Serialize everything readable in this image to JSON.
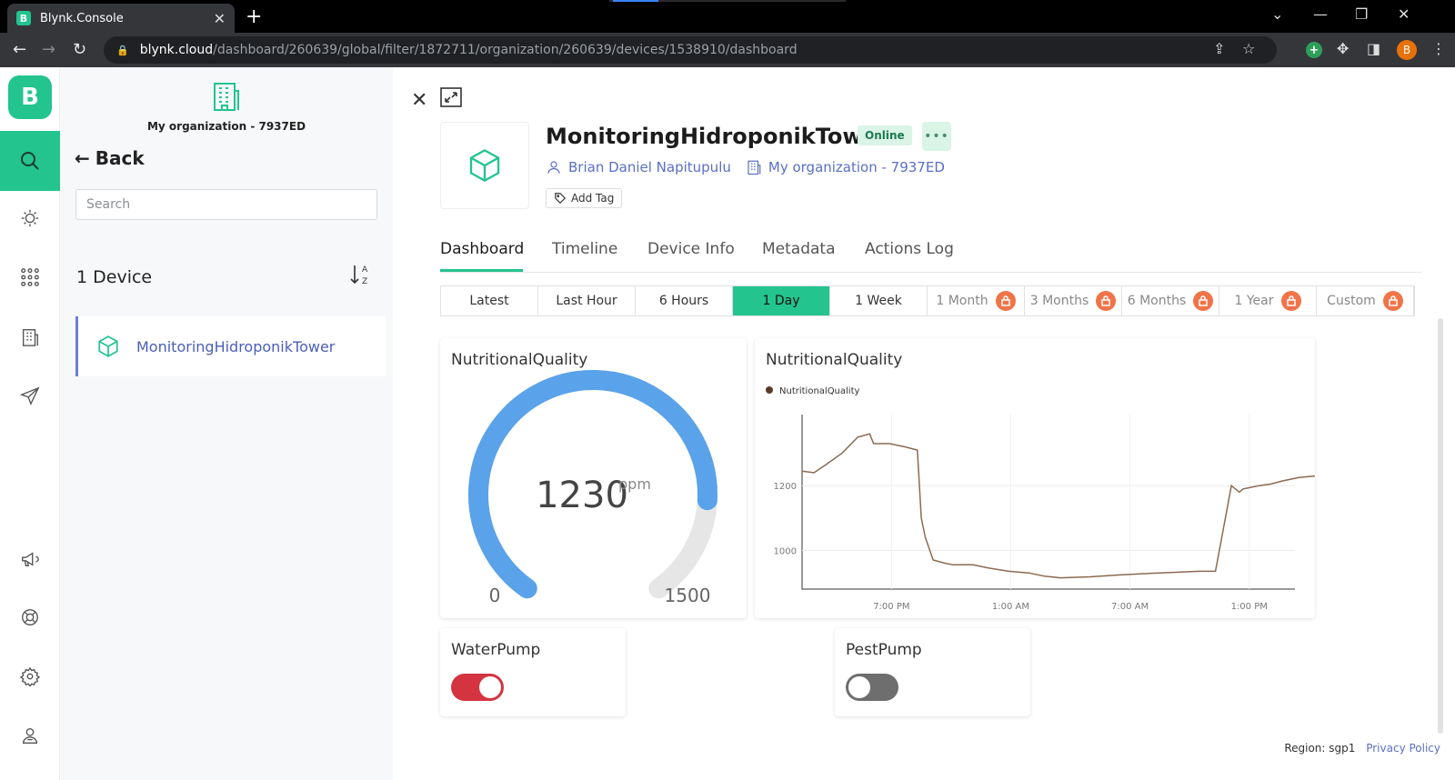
{
  "browser": {
    "tab_title": "Blynk.Console",
    "tab_favicon": "B",
    "url_host": "blynk.cloud",
    "url_path": "/dashboard/260639/global/filter/1872711/organization/260639/devices/1538910/dashboard",
    "profile_initial": "B"
  },
  "rail": {
    "logo": "B"
  },
  "panel": {
    "org_name": "My organization - 7937ED",
    "back_label": "Back",
    "search_placeholder": "Search",
    "device_count": "1 Device",
    "devices": [
      {
        "name": "MonitoringHidroponikTower"
      }
    ]
  },
  "device": {
    "name": "MonitoringHidroponikTower",
    "status": "Online",
    "owner": "Brian Daniel Napitupulu",
    "organization": "My organization - 7937ED",
    "add_tag_label": "Add Tag"
  },
  "tabs": [
    "Dashboard",
    "Timeline",
    "Device Info",
    "Metadata",
    "Actions Log"
  ],
  "time_ranges": [
    {
      "label": "Latest",
      "locked": false,
      "active": false
    },
    {
      "label": "Last Hour",
      "locked": false,
      "active": false
    },
    {
      "label": "6 Hours",
      "locked": false,
      "active": false
    },
    {
      "label": "1 Day",
      "locked": false,
      "active": true
    },
    {
      "label": "1 Week",
      "locked": false,
      "active": false
    },
    {
      "label": "1 Month",
      "locked": true,
      "active": false
    },
    {
      "label": "3 Months",
      "locked": true,
      "active": false
    },
    {
      "label": "6 Months",
      "locked": true,
      "active": false
    },
    {
      "label": "1 Year",
      "locked": true,
      "active": false
    },
    {
      "label": "Custom",
      "locked": true,
      "active": false
    }
  ],
  "gauge": {
    "title": "NutritionalQuality",
    "value": "1230",
    "unit": "ppm",
    "min": "0",
    "max": "1500",
    "fraction": 0.82
  },
  "chart_data": {
    "type": "line",
    "title": "NutritionalQuality",
    "series": [
      {
        "name": "NutritionalQuality",
        "x_hours": [
          0,
          0.6,
          1.2,
          2.0,
          2.8,
          3.4,
          3.6,
          4.4,
          5.2,
          5.8,
          6.0,
          6.2,
          6.6,
          7.2,
          7.6,
          8.6,
          9.4,
          10.4,
          11.4,
          12.2,
          13.0,
          14.5,
          16.0,
          18.0,
          20.0,
          20.8,
          21.6,
          22.0,
          22.2,
          22.6,
          23.0,
          23.6,
          24.2,
          25.0,
          25.8
        ],
        "y": [
          1245,
          1240,
          1265,
          1300,
          1350,
          1360,
          1330,
          1330,
          1320,
          1310,
          1100,
          1040,
          970,
          960,
          955,
          955,
          945,
          935,
          930,
          920,
          915,
          918,
          924,
          930,
          935,
          935,
          1200,
          1180,
          1190,
          1195,
          1200,
          1205,
          1215,
          1225,
          1230
        ]
      }
    ],
    "ylim": [
      880,
      1420
    ],
    "y_ticks": [
      "1000",
      "1200"
    ],
    "x_ticks": [
      {
        "x_hours": 4.5,
        "label": "7:00 PM"
      },
      {
        "x_hours": 10.5,
        "label": "1:00 AM"
      },
      {
        "x_hours": 16.5,
        "label": "7:00 AM"
      },
      {
        "x_hours": 22.5,
        "label": "1:00 PM"
      }
    ],
    "xlim": [
      0,
      24.8
    ],
    "legend": "top-left",
    "color": "#8b6a52",
    "grid": true
  },
  "waterpump": {
    "title": "WaterPump",
    "on": true
  },
  "pestpump": {
    "title": "PestPump",
    "on": false
  },
  "footer": {
    "region": "Region: sgp1",
    "privacy": "Privacy Policy"
  },
  "colors": {
    "accent": "#23c48e",
    "gauge": "#5aa2ea",
    "toggle_on": "#d33440",
    "lock": "#f07448"
  }
}
